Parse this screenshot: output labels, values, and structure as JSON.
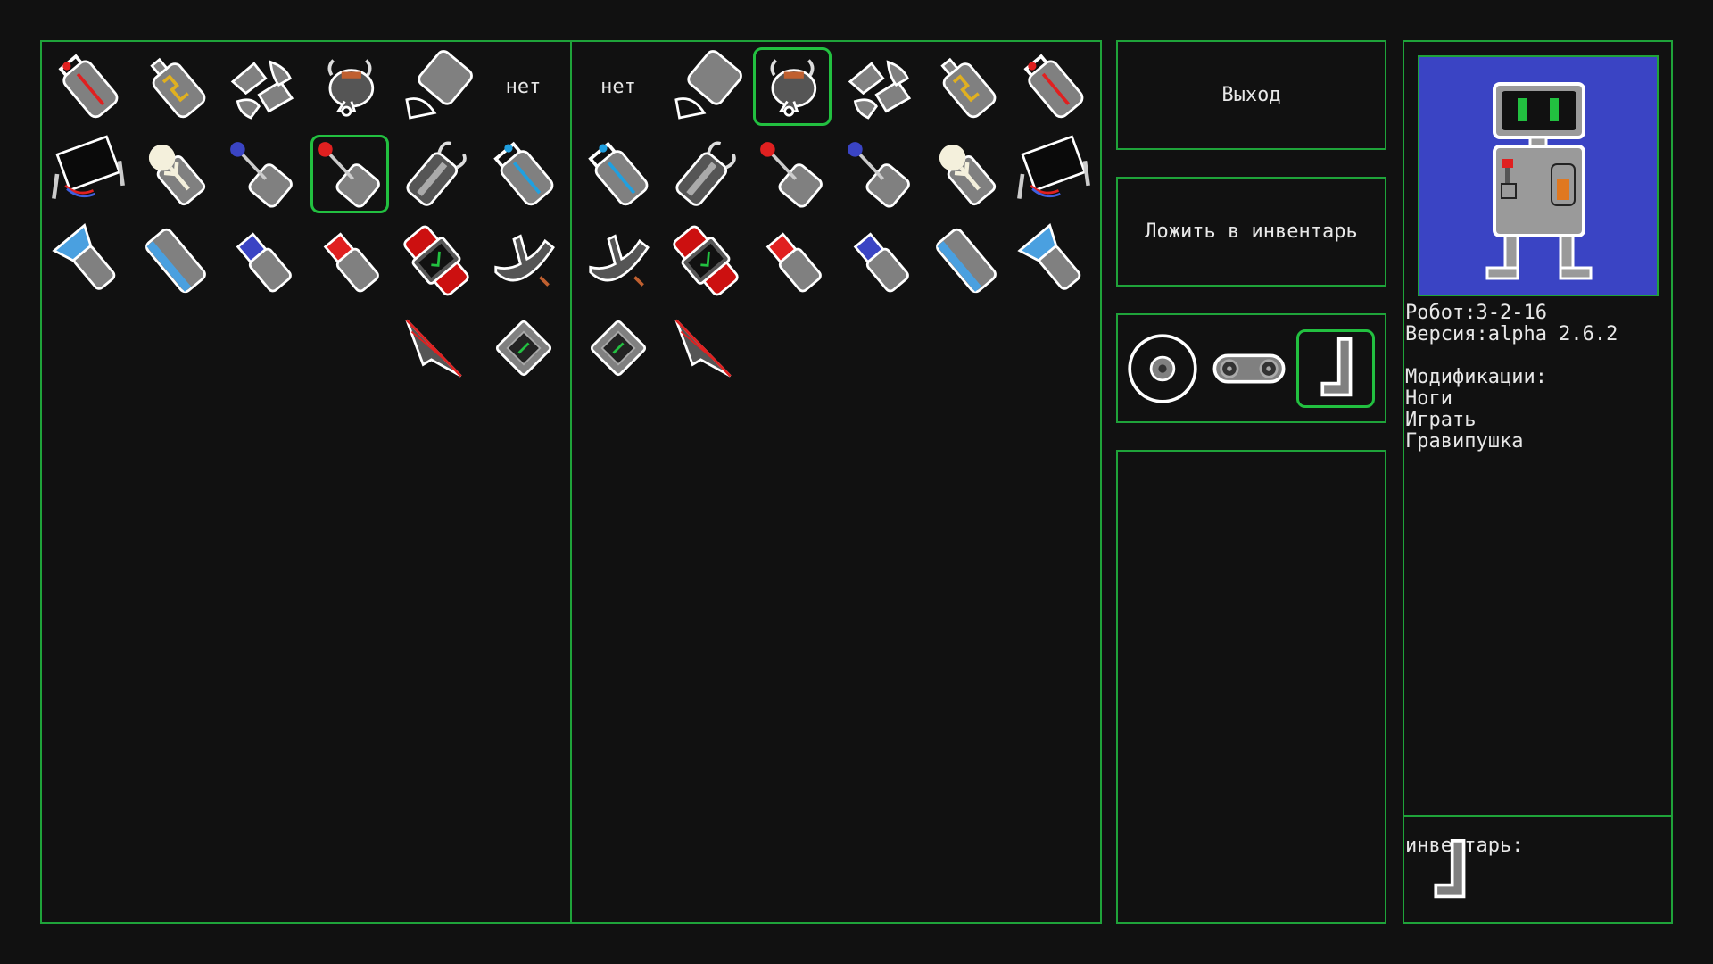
{
  "colors": {
    "background": "#111111",
    "border": "#1fa33a",
    "selected": "#22c040",
    "portrait_bg": "#3a44c4"
  },
  "left_grid": {
    "rows": [
      [
        {
          "icon": "battery-red-icon"
        },
        {
          "icon": "battery-yellow-icon"
        },
        {
          "icon": "bone-joint-icon"
        },
        {
          "icon": "claw-gripper-icon"
        },
        {
          "icon": "block-foot-icon"
        },
        {
          "text": "нет"
        }
      ],
      [
        {
          "icon": "screen-device-icon"
        },
        {
          "icon": "lamp-fork-icon"
        },
        {
          "icon": "lever-blue-icon"
        },
        {
          "icon": "lever-red-icon",
          "selected": true
        },
        {
          "icon": "canister-gray-icon"
        },
        {
          "icon": "battery-blue-icon"
        }
      ],
      [
        {
          "icon": "flashlight-icon"
        },
        {
          "icon": "cell-blue-icon"
        },
        {
          "icon": "chip-blue-icon"
        },
        {
          "icon": "chip-red-icon"
        },
        {
          "icon": "wrist-watch-icon"
        },
        {
          "icon": "bracket-arm-icon"
        }
      ],
      [
        {},
        {},
        {},
        {},
        {
          "icon": "arrow-head-icon"
        },
        {
          "icon": "diamond-plate-icon"
        }
      ]
    ]
  },
  "right_grid": {
    "rows": [
      [
        {
          "text": "нет"
        },
        {
          "icon": "block-foot-icon"
        },
        {
          "icon": "claw-gripper-icon",
          "selected": true
        },
        {
          "icon": "bone-joint-icon"
        },
        {
          "icon": "battery-yellow-icon"
        },
        {
          "icon": "battery-red-icon"
        }
      ],
      [
        {
          "icon": "battery-blue-icon"
        },
        {
          "icon": "canister-gray-icon"
        },
        {
          "icon": "lever-red-icon"
        },
        {
          "icon": "lever-blue-icon"
        },
        {
          "icon": "lamp-fork-icon"
        },
        {
          "icon": "screen-device-icon"
        }
      ],
      [
        {
          "icon": "bracket-arm-icon"
        },
        {
          "icon": "wrist-watch-icon"
        },
        {
          "icon": "chip-red-icon"
        },
        {
          "icon": "chip-blue-icon"
        },
        {
          "icon": "cell-blue-icon"
        },
        {
          "icon": "flashlight-icon"
        }
      ],
      [
        {
          "icon": "diamond-plate-icon"
        },
        {
          "icon": "arrow-head-icon"
        },
        {},
        {},
        {},
        {}
      ]
    ]
  },
  "buttons": {
    "exit_label": "Выход",
    "put_inventory_label": "Ложить в инвентарь"
  },
  "mobility": [
    {
      "icon": "wheel-icon"
    },
    {
      "icon": "track-tread-icon"
    },
    {
      "icon": "leg-icon",
      "selected": true
    }
  ],
  "robot": {
    "portrait_icon": "robot-portrait-icon",
    "name_line": "Робот:3-2-16",
    "version_line": "Версия:alpha 2.6.2",
    "mods_heading": "Модификации:",
    "mods": [
      "Ноги",
      "Играть",
      "Гравипушка"
    ],
    "inventory_label": "инвентарь:",
    "inventory_items": [
      {
        "icon": "leg-icon"
      }
    ]
  }
}
